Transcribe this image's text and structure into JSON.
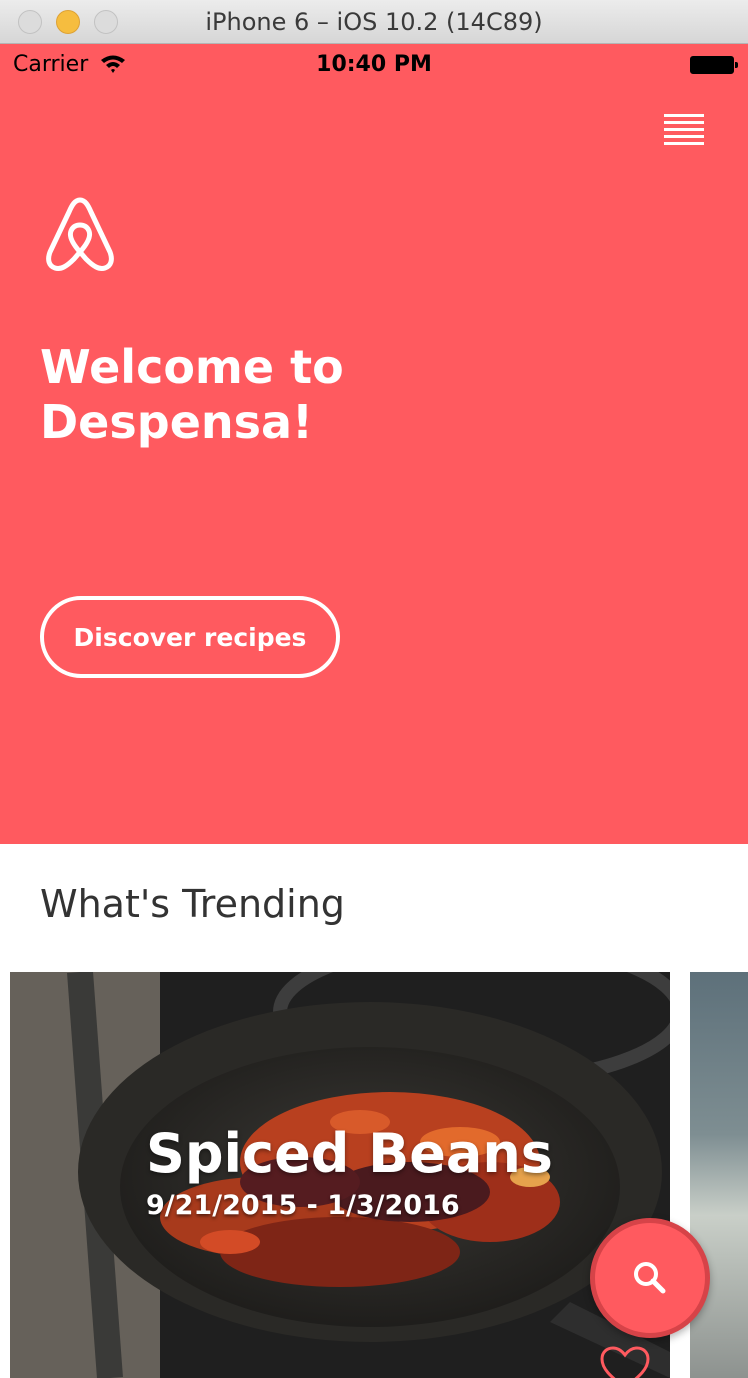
{
  "window": {
    "title": "iPhone 6 – iOS 10.2 (14C89)"
  },
  "status_bar": {
    "carrier": "Carrier",
    "time": "10:40 PM"
  },
  "colors": {
    "brand": "#ff5a5f",
    "text_dark": "#333333"
  },
  "hero": {
    "logo_icon": "airbnb-belo-icon",
    "menu_icon": "hamburger-menu-icon",
    "welcome_line1": "Welcome to",
    "welcome_line2": "Despensa!",
    "cta_label": "Discover recipes"
  },
  "trending": {
    "heading": "What's Trending",
    "cards": [
      {
        "title": "Spiced Beans",
        "dates": "9/21/2015 - 1/3/2016",
        "favorite_icon": "heart-outline-icon"
      }
    ]
  },
  "fab": {
    "icon": "search-icon"
  }
}
